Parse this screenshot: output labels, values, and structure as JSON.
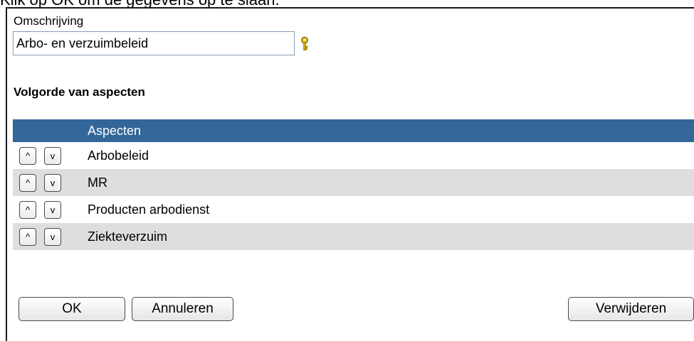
{
  "instruction_text": "Klik op OK om de gegevens op te slaan.",
  "form": {
    "description_label": "Omschrijving",
    "description_value": "Arbo- en verzuimbeleid",
    "key_icon": "key-icon",
    "section_title": "Volgorde van aspecten"
  },
  "grid": {
    "header": "Aspecten",
    "move_up_label": "^",
    "move_down_label": "v",
    "rows": [
      {
        "label": "Arbobeleid"
      },
      {
        "label": "MR"
      },
      {
        "label": "Producten arbodienst"
      },
      {
        "label": "Ziekteverzuim"
      }
    ]
  },
  "buttons": {
    "ok": "OK",
    "cancel": "Annuleren",
    "delete": "Verwijderen"
  },
  "colors": {
    "header_bg": "#336699",
    "alt_row_bg": "#dedede",
    "key_icon": "#e8c100"
  }
}
